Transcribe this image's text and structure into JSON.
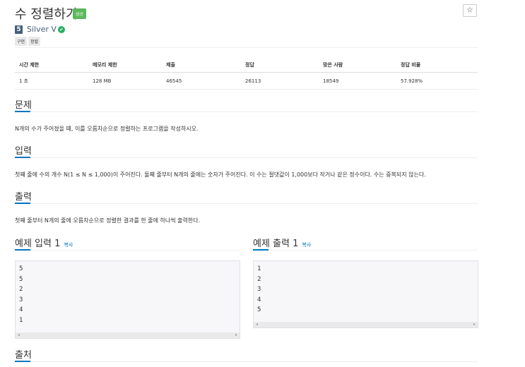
{
  "header": {
    "title": "수 정렬하기",
    "result_badge": "성공",
    "star_icon": "☆",
    "tier_number": "5",
    "tier_label": "Silver V",
    "tags": [
      "구현",
      "정렬"
    ]
  },
  "info_table": {
    "headers": [
      "시간 제한",
      "메모리 제한",
      "제출",
      "정답",
      "맞은 사람",
      "정답 비율"
    ],
    "values": [
      "1 초",
      "128 MB",
      "46545",
      "26113",
      "18549",
      "57.928%"
    ]
  },
  "sections": {
    "problem": {
      "heading": "문제",
      "text": "N개의 수가 주어졌을 때, 이를 오름차순으로 정렬하는 프로그램을 작성하시오."
    },
    "input": {
      "heading": "입력",
      "text": "첫째 줄에 수의 개수 N(1 ≤ N ≤ 1,000)이 주어진다. 둘째 줄부터 N개의 줄에는 숫자가 주어진다. 이 수는 절댓값이 1,000보다 작거나 같은 정수이다. 수는 중복되지 않는다."
    },
    "output": {
      "heading": "출력",
      "text": "첫째 줄부터 N개의 줄에 오름차순으로 정렬한 결과를 한 줄에 하나씩 출력한다."
    },
    "source": {
      "heading": "출처"
    }
  },
  "samples": {
    "input": {
      "heading": "예제 입력 1",
      "copy": "복사",
      "lines": [
        "5",
        "5",
        "2",
        "3",
        "4",
        "1"
      ]
    },
    "output": {
      "heading": "예제 출력 1",
      "copy": "복사",
      "lines": [
        "1",
        "2",
        "3",
        "4",
        "5"
      ]
    }
  },
  "scroll_arrows": {
    "left": "◂",
    "right": "▸"
  },
  "colors": {
    "success": "#5cb85c",
    "link": "#0076c0",
    "tier": "#435f7a",
    "check": "#27ae60"
  }
}
